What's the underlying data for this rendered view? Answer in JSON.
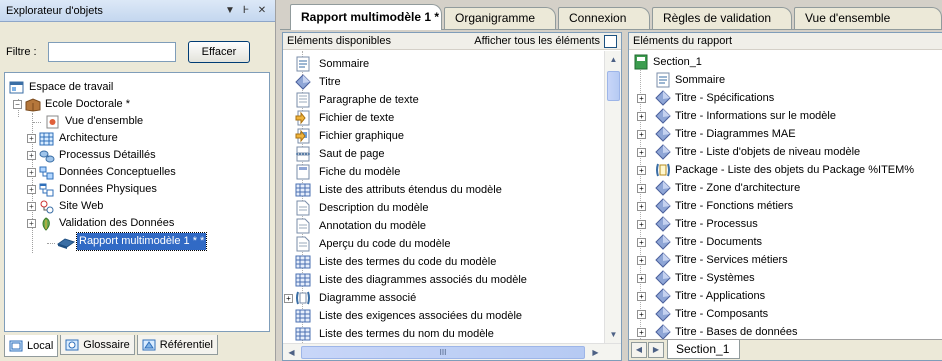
{
  "explorer": {
    "title": "Explorateur d'objets",
    "pin_glyph": "▼",
    "dock_glyph": "Ͱ",
    "close_glyph": "✕",
    "filter_label": "Filtre :",
    "filter_value": "",
    "clear_button": "Effacer",
    "tree": [
      {
        "label": "Espace de travail",
        "icon": "workspace-icon"
      },
      {
        "label": "Ecole Doctorale *",
        "icon": "project-icon"
      },
      {
        "label": "Vue d'ensemble",
        "icon": "overview-icon"
      },
      {
        "label": "Architecture",
        "icon": "grid-icon"
      },
      {
        "label": "Processus Détaillés",
        "icon": "process-icon"
      },
      {
        "label": "Données Conceptuelles",
        "icon": "conceptual-data-icon"
      },
      {
        "label": "Données Physiques",
        "icon": "physical-data-icon"
      },
      {
        "label": "Site Web",
        "icon": "website-icon"
      },
      {
        "label": "Validation des Données",
        "icon": "validation-icon"
      },
      {
        "label": "Rapport multimodèle 1 * *",
        "icon": "report-icon"
      }
    ],
    "bottom_tabs": [
      {
        "label": "Local",
        "icon": "local-icon"
      },
      {
        "label": "Glossaire",
        "icon": "glossary-icon"
      },
      {
        "label": "Référentiel",
        "icon": "repository-icon"
      }
    ]
  },
  "doc_tabs": [
    {
      "label": "Rapport multimodèle 1 *"
    },
    {
      "label": "Organigramme"
    },
    {
      "label": "Connexion"
    },
    {
      "label": "Règles de validation"
    },
    {
      "label": "Vue d'ensemble"
    }
  ],
  "available": {
    "header": "Eléments disponibles",
    "show_all_label": "Afficher tous les éléments",
    "show_all_checked": false,
    "items": [
      {
        "label": "Sommaire",
        "icon": "toc-icon"
      },
      {
        "label": "Titre",
        "icon": "title-icon"
      },
      {
        "label": "Paragraphe de texte",
        "icon": "paragraph-icon"
      },
      {
        "label": "Fichier de texte",
        "icon": "text-file-icon"
      },
      {
        "label": "Fichier graphique",
        "icon": "graphic-file-icon"
      },
      {
        "label": "Saut de page",
        "icon": "page-break-icon"
      },
      {
        "label": "Fiche du modèle",
        "icon": "model-card-icon"
      },
      {
        "label": "Liste des attributs étendus du modèle",
        "icon": "list-icon"
      },
      {
        "label": "Description du modèle",
        "icon": "document-icon"
      },
      {
        "label": "Annotation du modèle",
        "icon": "document-icon"
      },
      {
        "label": "Aperçu du code du modèle",
        "icon": "document-icon"
      },
      {
        "label": "Liste des termes du code du modèle",
        "icon": "list-icon"
      },
      {
        "label": "Liste des diagrammes associés du modèle",
        "icon": "list-icon"
      },
      {
        "label": "Diagramme associé",
        "icon": "diagram-icon"
      },
      {
        "label": "Liste des exigences associées du modèle",
        "icon": "list-icon"
      },
      {
        "label": "Liste des termes du nom du modèle",
        "icon": "list-icon"
      }
    ],
    "hscroll_glyph": "III"
  },
  "report": {
    "header": "Eléments du rapport",
    "items": [
      {
        "label": "Section_1",
        "icon": "section-icon"
      },
      {
        "label": "Sommaire",
        "icon": "toc-icon"
      },
      {
        "label": "Titre - Spécifications",
        "icon": "title-icon"
      },
      {
        "label": "Titre - Informations sur le modèle",
        "icon": "title-icon"
      },
      {
        "label": "Titre - Diagrammes MAE",
        "icon": "title-icon"
      },
      {
        "label": "Titre - Liste d'objets de niveau modèle",
        "icon": "title-icon"
      },
      {
        "label": "Package - Liste des objets du Package %ITEM%",
        "icon": "package-icon"
      },
      {
        "label": "Titre - Zone d'architecture",
        "icon": "title-icon"
      },
      {
        "label": "Titre - Fonctions métiers",
        "icon": "title-icon"
      },
      {
        "label": "Titre - Processus",
        "icon": "title-icon"
      },
      {
        "label": "Titre - Documents",
        "icon": "title-icon"
      },
      {
        "label": "Titre - Services métiers",
        "icon": "title-icon"
      },
      {
        "label": "Titre - Systèmes",
        "icon": "title-icon"
      },
      {
        "label": "Titre - Applications",
        "icon": "title-icon"
      },
      {
        "label": "Titre - Composants",
        "icon": "title-icon"
      },
      {
        "label": "Titre - Bases de données",
        "icon": "title-icon"
      }
    ],
    "section_tab": "Section_1"
  },
  "colors": {
    "selection": "#316ac5",
    "border": "#7f9db9"
  }
}
